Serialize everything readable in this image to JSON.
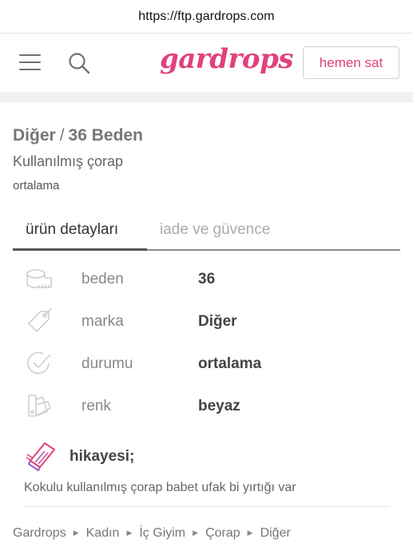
{
  "browser": {
    "url": "https://ftp.gardrops.com"
  },
  "header": {
    "logo_text": "gardrops",
    "sell_button": "hemen sat",
    "brand_color": "#e0417c"
  },
  "product": {
    "brand": "Diğer",
    "separator": "/",
    "size_title": "36 Beden",
    "name": "Kullanılmış çorap",
    "condition": "ortalama"
  },
  "tabs": [
    {
      "label": "ürün detayları",
      "active": true
    },
    {
      "label": "iade ve güvence",
      "active": false
    }
  ],
  "attributes": [
    {
      "icon": "tape-measure-icon",
      "label": "beden",
      "value": "36"
    },
    {
      "icon": "price-tag-icon",
      "label": "marka",
      "value": "Diğer"
    },
    {
      "icon": "check-circle-icon",
      "label": "durumu",
      "value": "ortalama"
    },
    {
      "icon": "color-swatch-icon",
      "label": "renk",
      "value": "beyaz"
    }
  ],
  "story": {
    "icon": "book-icon",
    "title": "hikayesi;",
    "text": "Kokulu kullanılmış çorap babet ufak bi yırtığı var"
  },
  "breadcrumb": [
    "Gardrops",
    "Kadın",
    "İç Giyim",
    "Çorap",
    "Diğer"
  ]
}
